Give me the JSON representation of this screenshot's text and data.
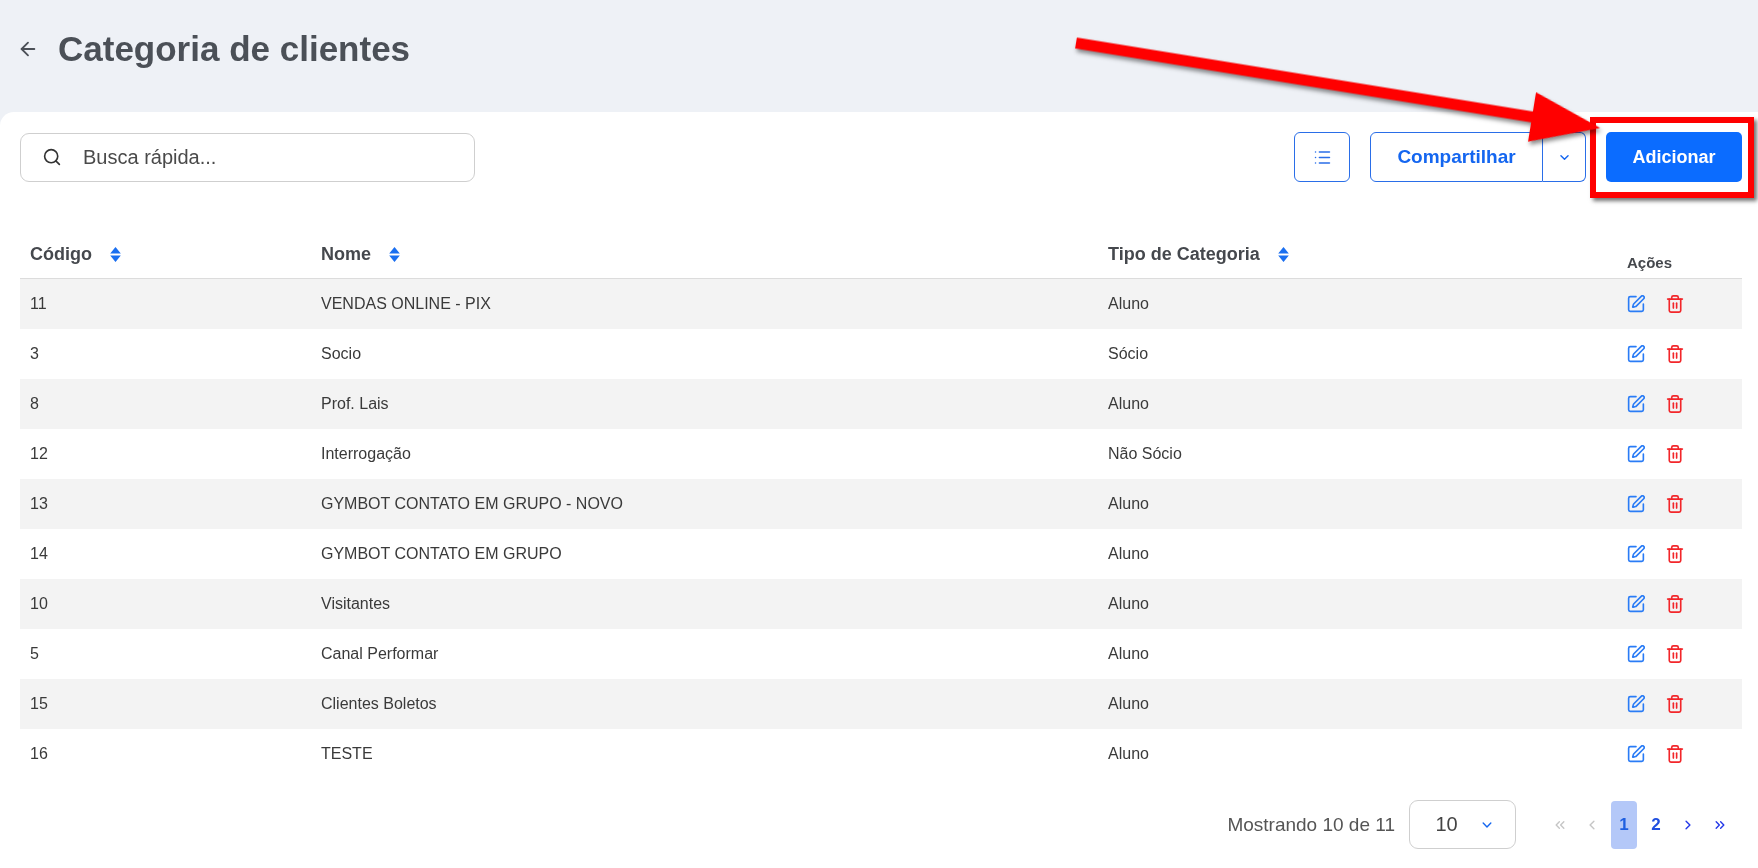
{
  "header": {
    "title": "Categoria de clientes"
  },
  "toolbar": {
    "search": {
      "placeholder": "Busca rápida..."
    },
    "buttons": [
      {
        "kind": "icon",
        "highlighted": false
      },
      {
        "kind": "split",
        "label": "Compartilhar",
        "highlighted": false
      },
      {
        "kind": "primary",
        "label": "Adicionar",
        "highlighted": true
      }
    ]
  },
  "table": {
    "columns": [
      {
        "label": "Código",
        "sortable": true
      },
      {
        "label": "Nome",
        "sortable": true
      },
      {
        "label": "Tipo de Categoria",
        "sortable": true
      },
      {
        "label": "Ações",
        "sortable": false
      }
    ],
    "rows": [
      {
        "code": "11",
        "name": "VENDAS ONLINE - PIX",
        "type": "Aluno"
      },
      {
        "code": "3",
        "name": "Socio",
        "type": "Sócio"
      },
      {
        "code": "8",
        "name": "Prof. Lais",
        "type": "Aluno"
      },
      {
        "code": "12",
        "name": "Interrogação",
        "type": "Não Sócio"
      },
      {
        "code": "13",
        "name": "GYMBOT CONTATO EM GRUPO - NOVO",
        "type": "Aluno"
      },
      {
        "code": "14",
        "name": "GYMBOT CONTATO EM GRUPO",
        "type": "Aluno"
      },
      {
        "code": "10",
        "name": "Visitantes",
        "type": "Aluno"
      },
      {
        "code": "5",
        "name": "Canal Performar",
        "type": "Aluno"
      },
      {
        "code": "15",
        "name": "Clientes Boletos",
        "type": "Aluno"
      },
      {
        "code": "16",
        "name": "TESTE",
        "type": "Aluno"
      }
    ]
  },
  "pagination": {
    "summary": "Mostrando 10 de 11",
    "page_size": "10",
    "first": {
      "disabled": true
    },
    "previous": {
      "disabled": true
    },
    "pages": [
      {
        "label": "1",
        "selected": true
      },
      {
        "label": "2",
        "selected": false
      }
    ],
    "next": {
      "disabled": false
    },
    "last": {
      "disabled": false
    }
  }
}
